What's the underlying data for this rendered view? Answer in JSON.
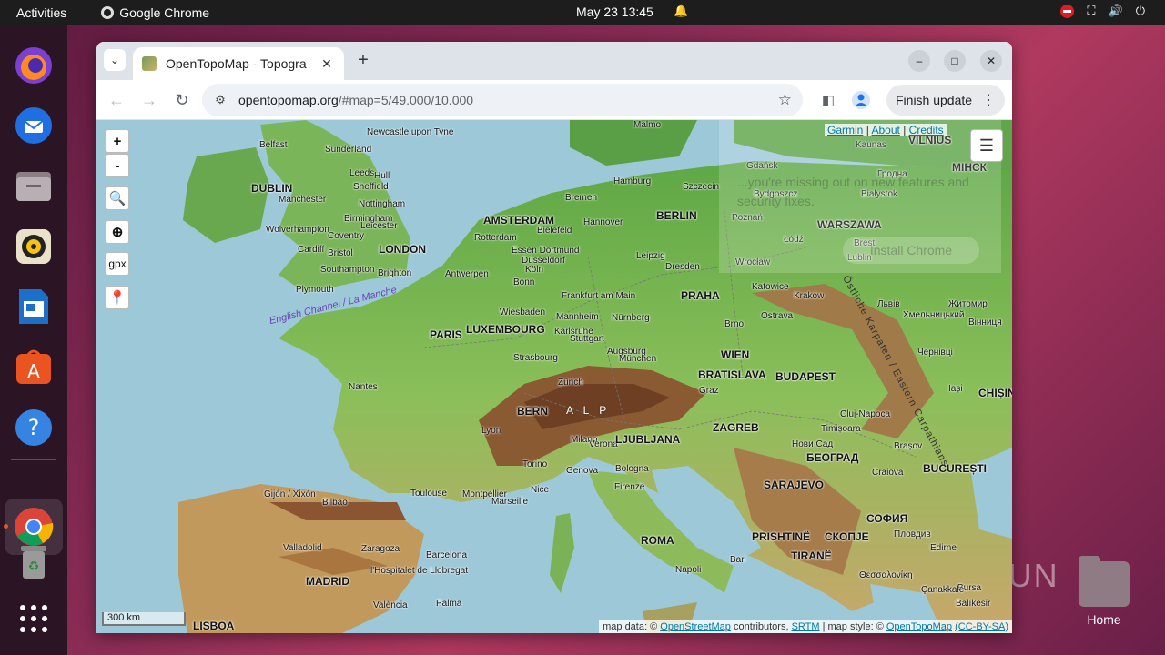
{
  "system": {
    "activities": "Activities",
    "app_name": "Google Chrome",
    "clock": "May 23  13:45"
  },
  "dock": {
    "items": [
      "firefox-icon",
      "thunderbird-icon",
      "files-icon",
      "rhythmbox-icon",
      "libreoffice-writer-icon",
      "app-center-icon",
      "help-icon",
      "chrome-icon",
      "trash-icon",
      "app-grid-icon"
    ]
  },
  "desktop": {
    "home_label": "Home"
  },
  "browser": {
    "tab_title": "OpenTopoMap - Topogra",
    "url_host": "opentopomap.org",
    "url_path": "/#map=5/49.000/10.000",
    "finish_update": "Finish update"
  },
  "map": {
    "zoom_in": "+",
    "zoom_out": "-",
    "gpx": "gpx",
    "links": {
      "garmin": "Garmin",
      "about": "About",
      "credits": "Credits",
      "sep": "|"
    },
    "promo_text": "...you're missing out on new features and security fixes.",
    "promo_button": "Install Chrome",
    "scale": "300 km",
    "attribution": {
      "prefix": "map data: ©",
      "osm": "OpenStreetMap",
      "mid1": "contributors,",
      "srtm": "SRTM",
      "mid2": "| map style: ©",
      "otm": "OpenTopoMap",
      "license": "(CC-BY-SA)"
    },
    "sea_label": "English Channel / La Manche",
    "mountain_label": "Östliche Karpaten / Eastern Carpathians",
    "alps_label": "A  L  P",
    "capitals": [
      [
        "DUBLIN",
        170,
        68
      ],
      [
        "LONDON",
        310,
        135
      ],
      [
        "AMSTERDAM",
        425,
        103
      ],
      [
        "BERLIN",
        615,
        98
      ],
      [
        "WARSZAWA",
        792,
        108
      ],
      [
        "МІНСК",
        940,
        45
      ],
      [
        "VILNIUS",
        892,
        15
      ],
      [
        "PARIS",
        366,
        229
      ],
      [
        "LUXEMBOURG",
        406,
        223
      ],
      [
        "PRAHA",
        642,
        186
      ],
      [
        "WIEN",
        686,
        251
      ],
      [
        "BRATISLAVA",
        661,
        273
      ],
      [
        "BUDAPEST",
        746,
        275
      ],
      [
        "BERN",
        462,
        313
      ],
      [
        "LJUBLJANA",
        570,
        344
      ],
      [
        "ZAGREB",
        677,
        331
      ],
      [
        "БЕОГРАД",
        780,
        364
      ],
      [
        "BUCUREȘTI",
        908,
        376
      ],
      [
        "SARAJEVO",
        733,
        394
      ],
      [
        "ROMA",
        598,
        455
      ],
      [
        "PRISHTINË",
        720,
        451
      ],
      [
        "СКОПЈЕ",
        800,
        451
      ],
      [
        "TIRANË",
        763,
        472
      ],
      [
        "СОФИЯ",
        846,
        431
      ],
      [
        "MADRID",
        230,
        500
      ],
      [
        "LISBOA",
        106,
        549
      ],
      [
        "CHIȘIN",
        969,
        293
      ]
    ],
    "cities": [
      [
        "Malmo",
        590,
        0
      ],
      [
        "Newcastle upon Tyne",
        297,
        8
      ],
      [
        "Belfast",
        179,
        22
      ],
      [
        "Sunderland",
        251,
        27
      ],
      [
        "Leeds",
        278,
        53
      ],
      [
        "Hull",
        305,
        56
      ],
      [
        "Sheffield",
        282,
        68
      ],
      [
        "Nottingham",
        288,
        87
      ],
      [
        "Manchester",
        200,
        82
      ],
      [
        "Birmingham",
        272,
        103
      ],
      [
        "Leicester",
        290,
        111
      ],
      [
        "Wolverhampton",
        186,
        115
      ],
      [
        "Coventry",
        254,
        122
      ],
      [
        "Cardiff",
        221,
        137
      ],
      [
        "Bristol",
        254,
        141
      ],
      [
        "Southampton",
        246,
        159
      ],
      [
        "Brighton",
        309,
        163
      ],
      [
        "Plymouth",
        219,
        181
      ],
      [
        "Hamburg",
        568,
        62
      ],
      [
        "Szczecin",
        644,
        68
      ],
      [
        "Bremen",
        515,
        80
      ],
      [
        "Hannover",
        535,
        107
      ],
      [
        "Rotterdam",
        415,
        124
      ],
      [
        "Bielefeld",
        484,
        116
      ],
      [
        "Essen Dortmund",
        456,
        138
      ],
      [
        "Düsseldorf",
        467,
        149
      ],
      [
        "Köln",
        471,
        159
      ],
      [
        "Antwerpen",
        383,
        164
      ],
      [
        "Bonn",
        458,
        173
      ],
      [
        "Leipzig",
        593,
        144
      ],
      [
        "Dresden",
        625,
        156
      ],
      [
        "Frankfurt am Main",
        511,
        188
      ],
      [
        "Wiesbaden",
        443,
        206
      ],
      [
        "Mannheim",
        505,
        211
      ],
      [
        "Nürnberg",
        566,
        212
      ],
      [
        "Karlsruhe",
        503,
        227
      ],
      [
        "Stuttgart",
        520,
        235
      ],
      [
        "Augsburg",
        561,
        249
      ],
      [
        "München",
        574,
        257
      ],
      [
        "Strasbourg",
        458,
        256
      ],
      [
        "Zürich",
        507,
        283
      ],
      [
        "Nantes",
        277,
        288
      ],
      [
        "Lyon",
        423,
        336
      ],
      [
        "Milano",
        521,
        346
      ],
      [
        "Verona",
        541,
        351
      ],
      [
        "Torino",
        468,
        373
      ],
      [
        "Genova",
        516,
        380
      ],
      [
        "Bologna",
        570,
        378
      ],
      [
        "Firenze",
        569,
        398
      ],
      [
        "Nice",
        477,
        401
      ],
      [
        "Toulouse",
        345,
        405
      ],
      [
        "Montpellier",
        402,
        406
      ],
      [
        "Marseille",
        434,
        414
      ],
      [
        "Gijón / Xixón",
        184,
        406
      ],
      [
        "Bilbao",
        248,
        415
      ],
      [
        "Valladolid",
        205,
        465
      ],
      [
        "Zaragoza",
        291,
        466
      ],
      [
        "Barcelona",
        362,
        473
      ],
      [
        "l'Hospitalet de Llobregat",
        301,
        490
      ],
      [
        "València",
        304,
        528
      ],
      [
        "Palma",
        373,
        526
      ],
      [
        "Napoli",
        636,
        489
      ],
      [
        "Bari",
        696,
        478
      ],
      [
        "Gdańsk",
        714,
        45
      ],
      [
        "Bydgoszcz",
        722,
        76
      ],
      [
        "Poznań",
        698,
        102
      ],
      [
        "Łódź",
        755,
        126
      ],
      [
        "Białystok",
        840,
        76
      ],
      [
        "Brest",
        832,
        130
      ],
      [
        "Lublin",
        825,
        146
      ],
      [
        "Wrocław",
        702,
        151
      ],
      [
        "Katowice",
        720,
        178
      ],
      [
        "Kraków",
        766,
        188
      ],
      [
        "Ostrava",
        730,
        210
      ],
      [
        "Brno",
        690,
        219
      ],
      [
        "Graz",
        662,
        292
      ],
      [
        "Timișoara",
        796,
        334
      ],
      [
        "Cluj-Napoca",
        817,
        318
      ],
      [
        "Brașov",
        876,
        353
      ],
      [
        "Craiova",
        852,
        382
      ],
      [
        "Нови Сад",
        764,
        351
      ],
      [
        "Kaunas",
        834,
        22
      ],
      [
        "Гродна",
        858,
        54
      ],
      [
        "Львів",
        858,
        197
      ],
      [
        "Житомир",
        936,
        197
      ],
      [
        "Хмельницький",
        886,
        209
      ],
      [
        "Вінниця",
        958,
        217
      ],
      [
        "Чернівці",
        902,
        250
      ],
      [
        "Iași",
        936,
        290
      ],
      [
        "Пловдив",
        876,
        450
      ],
      [
        "Edirne",
        916,
        465
      ],
      [
        "Θεσσαλονίκη",
        838,
        495
      ],
      [
        "Balıkesir",
        944,
        526
      ],
      [
        "Bursa",
        946,
        509
      ],
      [
        "Çanakkale",
        906,
        511
      ]
    ]
  }
}
